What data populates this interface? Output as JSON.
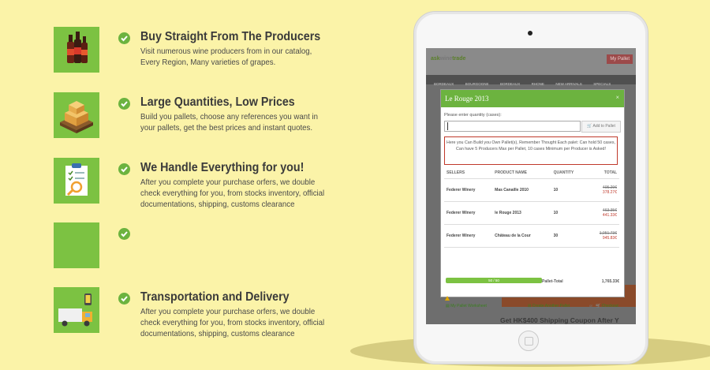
{
  "features": [
    {
      "icon": "wine-bottles-icon",
      "title": "Buy Straight From The Producers",
      "lines": [
        "Visit numerous wine producers from in our catalog,",
        "Every Region, Many varieties of grapes."
      ]
    },
    {
      "icon": "pallet-boxes-icon",
      "title": "Large Quantities, Low Prices",
      "lines": [
        "Build you pallets, choose any references you want in",
        "your pallets, get the best prices and instant quotes."
      ]
    },
    {
      "icon": "checklist-clipboard-icon",
      "title": "We Handle Everything for you!",
      "lines": [
        "After you complete your purchase orfers, we double",
        "check everything for you, from stocks inventory, official",
        "documentations, shipping, customs clearance"
      ]
    },
    {
      "icon": "blank-icon",
      "title": "",
      "lines": []
    },
    {
      "icon": "delivery-truck-icon",
      "title": "Transportation and Delivery",
      "lines": [
        "After you complete your purchase orfers, we double",
        "check everything for you, from stocks inventory, official",
        "documentations, shipping, customs clearance"
      ]
    }
  ],
  "tablet": {
    "site": {
      "logo_left": "ask",
      "logo_mid": "wine",
      "logo_right": "trade",
      "my_pallet": "My Pallet",
      "nav": [
        "BORDEAUX",
        "BOURGOGNE",
        "BORDEAUX",
        "RHONE",
        "NEW ARRIVALS",
        "SPECIALS"
      ],
      "coupon": "Get HK$400 Shipping Coupon After Y"
    },
    "modal": {
      "title": "Le Rouge 2013",
      "close": "×",
      "qty_label": "Please enter quantity (cases):",
      "add_button": "Add to Pallet",
      "notice": "Here you Can Build you Own Pallet(s), Remember Thought Each palet: Can hold 50 cases, Can have 5 Producers Max per Pallet, 10 cases Minimum per Producer is Asked!",
      "columns": [
        "SELLERS",
        "PRODUCT NAME",
        "QUANTITY",
        "TOTAL"
      ],
      "rows": [
        {
          "seller": "Federer Winery",
          "product": "Mas Canaille 2010",
          "qty": "10",
          "old": "405.29€",
          "new": "378.27€"
        },
        {
          "seller": "Federer Winery",
          "product": "le Rouge 2013",
          "qty": "10",
          "old": "463.35€",
          "new": "441.33€"
        },
        {
          "seller": "Federer Winery",
          "product": "Château de la Cour",
          "qty": "30",
          "old": "1,051.73€",
          "new": "945.83€"
        }
      ],
      "progress": "50 / 50",
      "pallet_total_label": "Pallet-Total",
      "pallet_total_value": "1,765.33€",
      "worksheet": "My Pallet Worksheet",
      "create": "Create Another Pallet",
      "or": "or",
      "checkout": "Checkout"
    }
  }
}
